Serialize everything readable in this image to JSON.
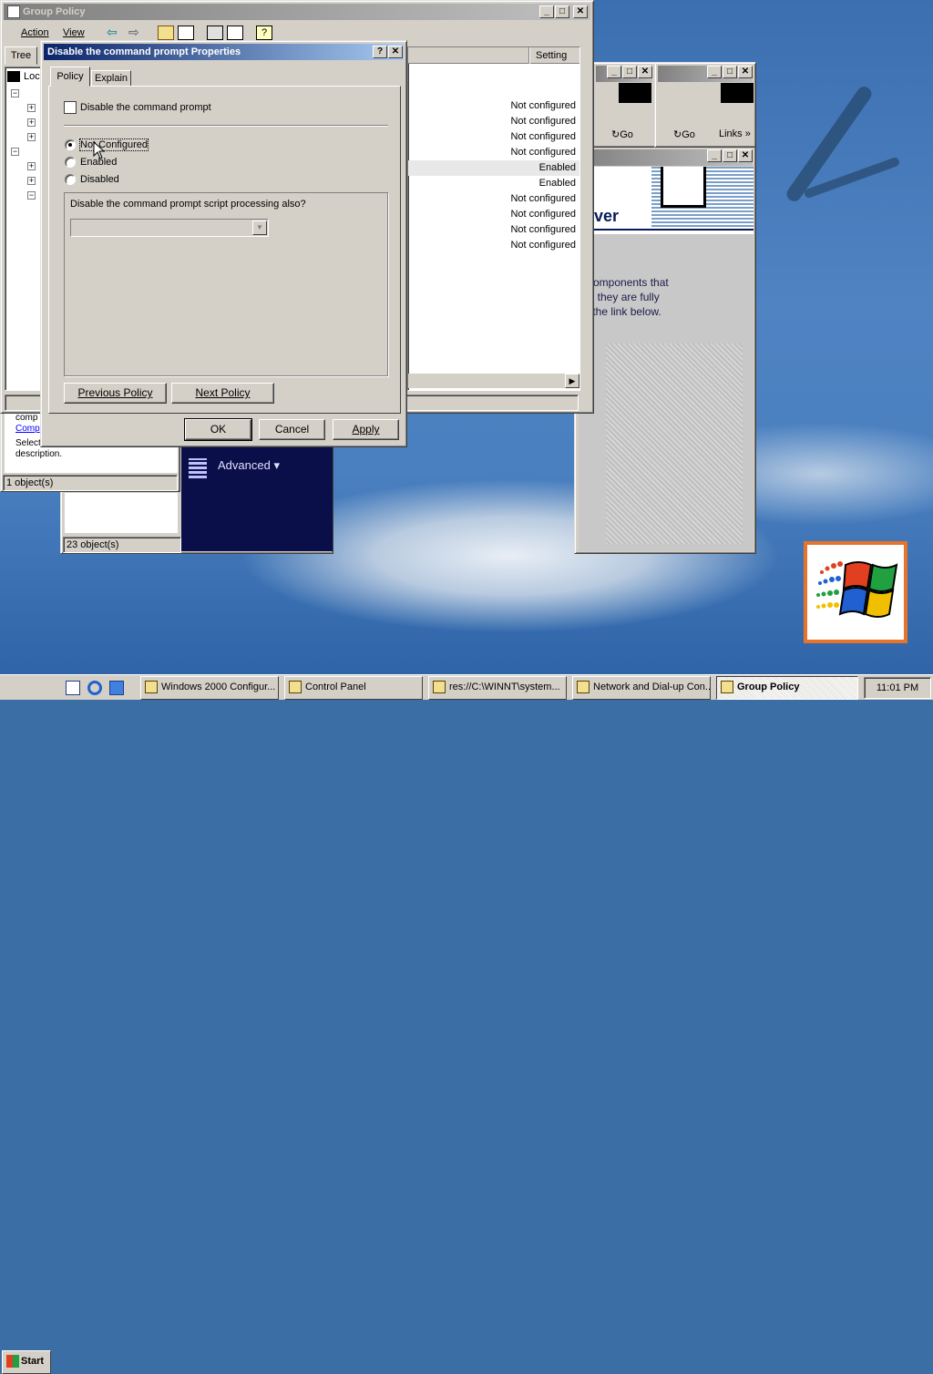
{
  "desktop": {
    "taskbar_clock": "11:01 PM"
  },
  "group_policy": {
    "title": "Group Policy",
    "menu": [
      "Action",
      "View"
    ],
    "tree_tab": "Tree",
    "tree_root": "Loca",
    "settings_header": "Setting",
    "rows": [
      {
        "setting": "Not configured"
      },
      {
        "setting": "Not configured"
      },
      {
        "setting": "Not configured"
      },
      {
        "setting": "Not configured"
      },
      {
        "setting": "Enabled"
      },
      {
        "setting": "Enabled"
      },
      {
        "setting": "Not configured"
      },
      {
        "setting": "Not configured"
      },
      {
        "setting": "Not configured"
      },
      {
        "setting": "Not configured"
      }
    ]
  },
  "control_panel": {
    "desc_line1": "comp",
    "desc_link": "Comp",
    "select_help": "Select an item to view its description.",
    "status": "1 object(s)"
  },
  "network_window": {
    "status": "23 object(s)"
  },
  "browser": {
    "go_label": "Go",
    "links_label": "Links",
    "banner_text": "erver",
    "body_lines": [
      "d components that",
      "ore they are fully",
      "ck the link below."
    ],
    "advanced_label": "Advanced"
  },
  "dialog": {
    "title": "Disable the command prompt Properties",
    "tabs": [
      "Policy",
      "Explain"
    ],
    "policy_name": "Disable the command prompt",
    "options": [
      "Not Configured",
      "Enabled",
      "Disabled"
    ],
    "selected_option": "Not Configured",
    "sub_question": "Disable the command prompt script processing also?",
    "dropdown_value": "",
    "prev_button": "Previous Policy",
    "next_button": "Next Policy",
    "ok": "OK",
    "cancel": "Cancel",
    "apply": "Apply"
  },
  "taskbar": {
    "start": "Start",
    "items": [
      {
        "label": "Windows 2000 Configur...",
        "pressed": false
      },
      {
        "label": "Control Panel",
        "pressed": false
      },
      {
        "label": "res://C:\\WINNT\\system...",
        "pressed": false
      },
      {
        "label": "Network and Dial-up Con...",
        "pressed": false
      },
      {
        "label": "Group Policy",
        "pressed": true
      }
    ]
  }
}
